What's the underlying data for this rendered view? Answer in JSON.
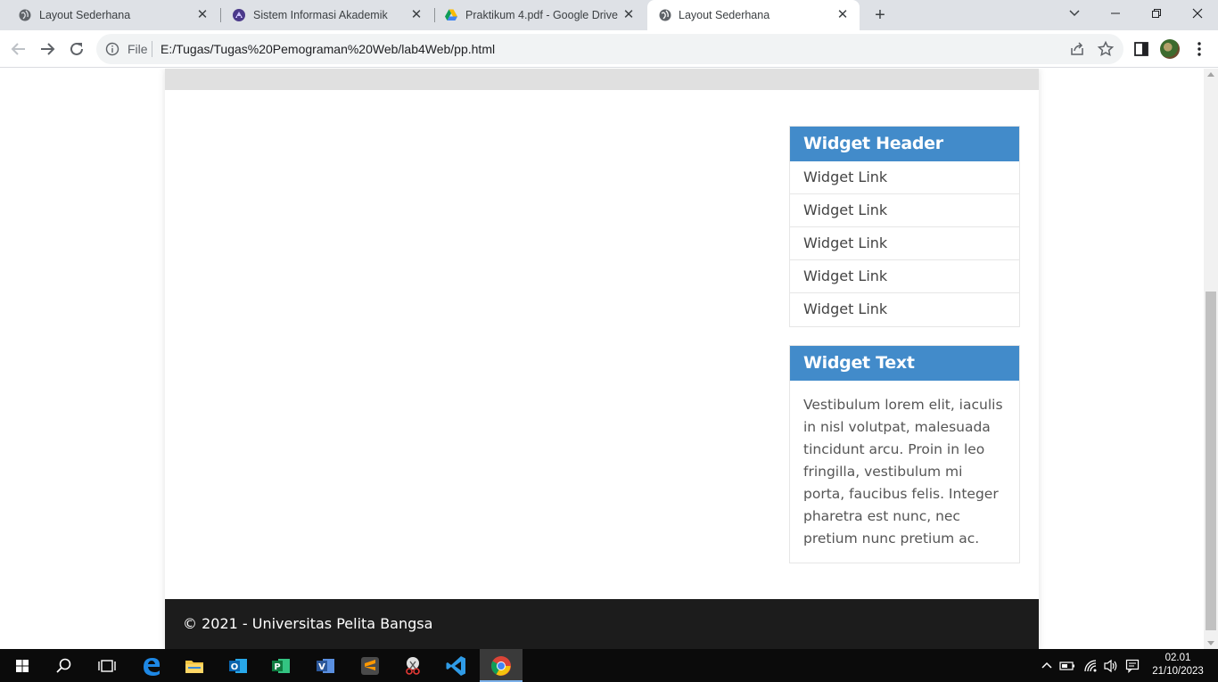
{
  "browser": {
    "tabs": [
      {
        "title": "Layout Sederhana",
        "favicon": "globe-icon",
        "active": false
      },
      {
        "title": "Sistem Informasi Akademik",
        "favicon": "university-logo-icon",
        "active": false
      },
      {
        "title": "Praktikum 4.pdf - Google Drive",
        "favicon": "google-drive-icon",
        "active": false
      },
      {
        "title": "Layout Sederhana",
        "favicon": "globe-icon",
        "active": true
      }
    ],
    "address": {
      "scheme_label": "File",
      "url": "E:/Tugas/Tugas%20Pemograman%20Web/lab4Web/pp.html"
    }
  },
  "page": {
    "widget_links": {
      "header": "Widget Header",
      "links": [
        "Widget Link",
        "Widget Link",
        "Widget Link",
        "Widget Link",
        "Widget Link"
      ]
    },
    "widget_text": {
      "header": "Widget Text",
      "body": "Vestibulum lorem elit, iaculis in nisl volutpat, malesuada tincidunt arcu. Proin in leo fringilla, vestibulum mi porta, faucibus felis. Integer pharetra est nunc, nec pretium nunc pretium ac."
    },
    "footer": "© 2021 - Universitas Pelita Bangsa",
    "colors": {
      "widget_header_bg": "#428bca",
      "footer_bg": "#1c1c1c"
    }
  },
  "taskbar": {
    "apps": [
      "windows-start-icon",
      "search-icon",
      "task-view-icon",
      "edge-icon",
      "file-explorer-icon",
      "outlook-icon",
      "project-icon",
      "visio-icon",
      "sublime-text-icon",
      "snipping-tool-icon",
      "vscode-icon",
      "chrome-icon"
    ],
    "clock": {
      "time": "02.01",
      "date": "21/10/2023"
    }
  }
}
